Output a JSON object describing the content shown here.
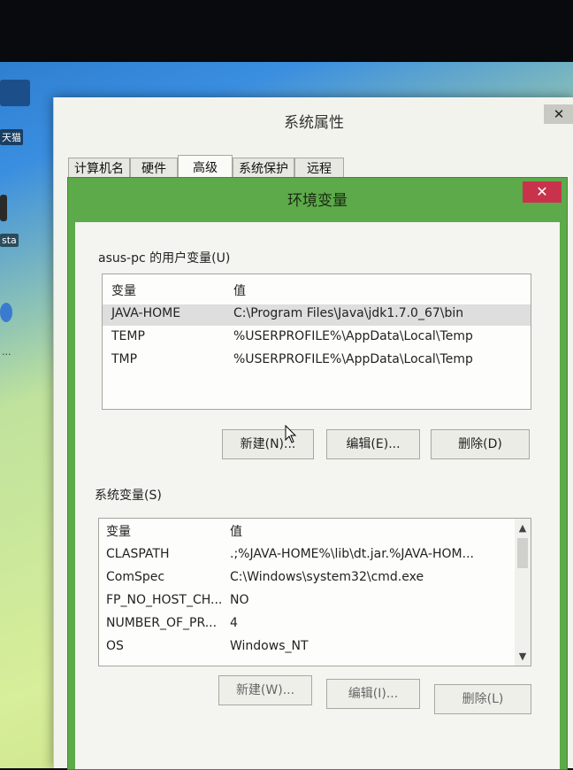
{
  "desktop": {
    "icon_labels": [
      "天猫",
      "sta",
      "..."
    ]
  },
  "system_properties": {
    "title": "系统属性",
    "close_glyph": "✕",
    "tabs": [
      "计算机名",
      "硬件",
      "高级",
      "系统保护",
      "远程"
    ],
    "active_tab": "高级"
  },
  "env_dialog": {
    "title": "环境变量",
    "close_glyph": "✕",
    "user_vars": {
      "label": "asus-pc 的用户变量(U)",
      "col_var": "变量",
      "col_val": "值",
      "rows": [
        {
          "name": "JAVA-HOME",
          "value": "C:\\Program Files\\Java\\jdk1.7.0_67\\bin"
        },
        {
          "name": "TEMP",
          "value": "%USERPROFILE%\\AppData\\Local\\Temp"
        },
        {
          "name": "TMP",
          "value": "%USERPROFILE%\\AppData\\Local\\Temp"
        }
      ],
      "buttons": {
        "new": "新建(N)...",
        "edit": "编辑(E)...",
        "delete": "删除(D)"
      }
    },
    "system_vars": {
      "label": "系统变量(S)",
      "col_var": "变量",
      "col_val": "值",
      "rows": [
        {
          "name": "CLASPATH",
          "value": ".;%JAVA-HOME%\\lib\\dt.jar.%JAVA-HOM..."
        },
        {
          "name": "ComSpec",
          "value": "C:\\Windows\\system32\\cmd.exe"
        },
        {
          "name": "FP_NO_HOST_CH...",
          "value": "NO"
        },
        {
          "name": "NUMBER_OF_PR...",
          "value": "4"
        },
        {
          "name": "OS",
          "value": "Windows_NT"
        }
      ],
      "buttons": {
        "new": "新建(W)...",
        "edit": "编辑(I)...",
        "delete": "删除(L)"
      }
    }
  },
  "colors": {
    "dialog_green": "#5daa4a",
    "close_red": "#c8334b"
  }
}
